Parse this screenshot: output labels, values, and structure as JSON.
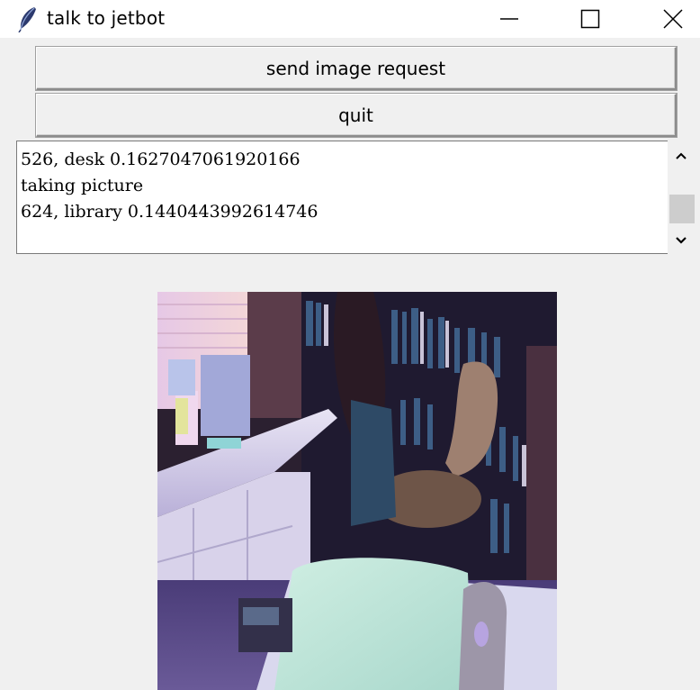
{
  "window": {
    "title": "talk to jetbot",
    "icon": "feather-icon",
    "controls": [
      "minimize-icon",
      "maximize-icon",
      "close-icon"
    ]
  },
  "buttons": {
    "send": "send image request",
    "quit": "quit"
  },
  "log": {
    "lines": [
      "526, desk 0.1627047061920166",
      "taking picture",
      "624, library 0.1440443992614746"
    ]
  },
  "scrollbar": {
    "up_icon": "chevron-up-icon",
    "down_icon": "chevron-down-icon"
  },
  "image": {
    "description_icon": "camera-photo"
  },
  "colors": {
    "window_bg": "#f0f0f0",
    "titlebar_bg": "#ffffff",
    "textbox_bg": "#ffffff"
  }
}
